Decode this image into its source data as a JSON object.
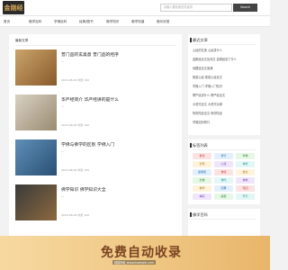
{
  "header": {
    "logo_text": "金刚经",
    "search_placeholder": "请输入要检索的关键词",
    "search_button": "Search"
  },
  "nav": {
    "items": [
      "首页",
      "佛学百科",
      "学佛百科",
      "经典/图书",
      "佛学知识",
      "佛学知道",
      "佛乐欣赏"
    ]
  },
  "main": {
    "section_title": "最新文章",
    "articles": [
      {
        "title": "普门品的玄奥意 普门品的经序",
        "summary": "...",
        "meta": "2019-08-09 浏览 100"
      },
      {
        "title": "华严经简介 华严经讲的是什么",
        "summary": "...",
        "meta": "2019-08-09 浏览 100"
      },
      {
        "title": "学佛与佛学的区别 学佛入门",
        "summary": "...",
        "meta": "2019-08-09 浏览 100"
      },
      {
        "title": "佛学知识 佛学知识大全",
        "summary": "...",
        "meta": "2019-08-09 浏览 100"
      }
    ]
  },
  "sidebar": {
    "recent_title": "最近文章",
    "recent_items": [
      "心经的玄奥 心经讲什么",
      "金刚经全文及译文 金刚经讲了什么",
      "地藏经全文读诵",
      "般若心经 般若心经全文",
      "学佛入门 学佛入门知识",
      "楞严经讲什么 楞严经全文",
      "大悲咒全文 大悲咒功德",
      "阿弥陀经全文 阿弥陀经",
      "学佛如何修行"
    ],
    "tags_title": "标签列表",
    "tags": [
      "佛法",
      "修行",
      "学佛",
      "智慧",
      "心经",
      "禅修",
      "金刚经",
      "佛经",
      "放生",
      "念佛",
      "佛陀",
      "佛教",
      "佛学",
      "因果",
      "轮回",
      "禅宗",
      "般若",
      "开示"
    ],
    "category_title": "佛学百科"
  },
  "banner": {
    "text": "免费自动收录",
    "subtext": "链接网址 www.example.com"
  },
  "colors": {
    "accent": "#333333",
    "banner_bg": "#f0c987",
    "banner_text": "#7a4422"
  }
}
